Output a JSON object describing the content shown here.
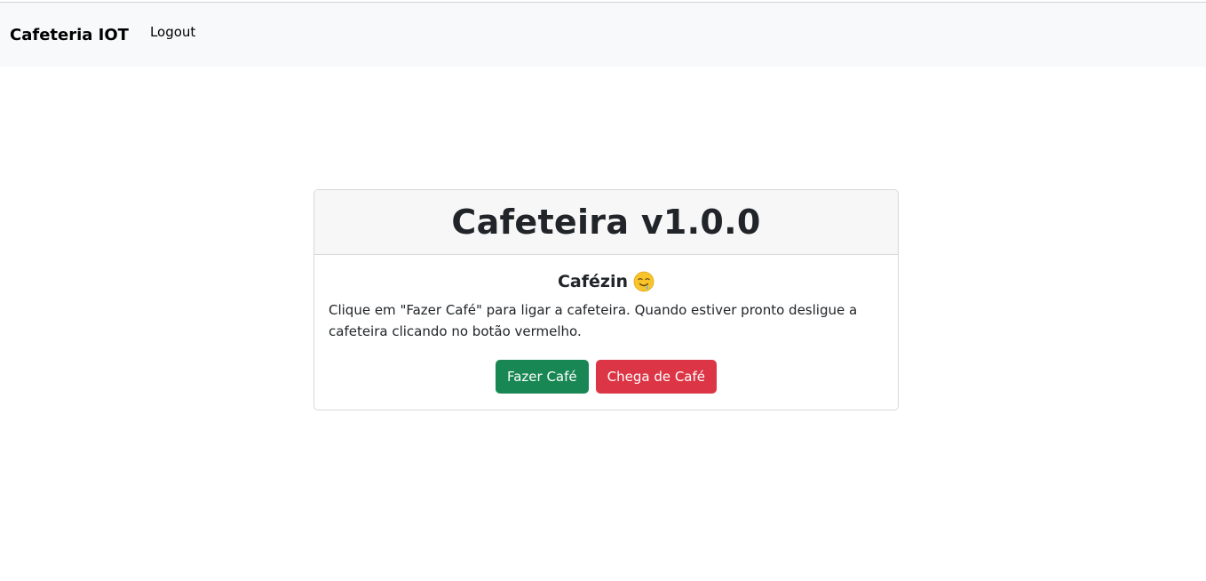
{
  "navbar": {
    "brand": "Cafeteria IOT",
    "logout_label": "Logout"
  },
  "card": {
    "title": "Cafeteira v1.0.0",
    "subtitle": "Cafézin",
    "subtitle_icon": "drooling-face-emoji",
    "description": "Clique em \"Fazer Café\" para ligar a cafeteira. Quando estiver pronto desligue a cafeteira clicando no botão vermelho.",
    "make_coffee_label": "Fazer Café",
    "stop_coffee_label": "Chega de Café"
  },
  "colors": {
    "navbar_bg": "#f8f9fa",
    "success": "#198754",
    "danger": "#dc3545"
  }
}
